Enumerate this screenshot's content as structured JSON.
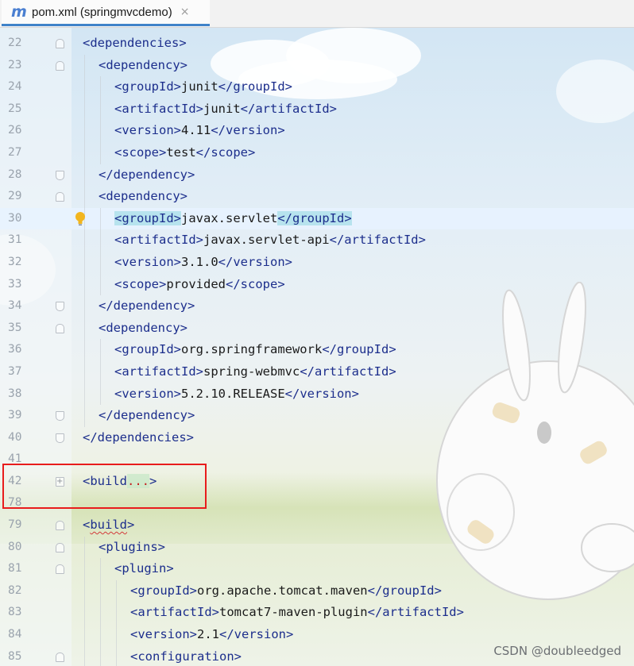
{
  "tab": {
    "icon": "m",
    "title": "pom.xml (springmvcdemo)",
    "close": "×"
  },
  "lines": [
    {
      "n": "22",
      "indent": 0,
      "fold": "start",
      "parts": [
        [
          "t",
          "<dependencies"
        ],
        [
          "t",
          ">"
        ]
      ]
    },
    {
      "n": "23",
      "indent": 1,
      "fold": "start",
      "parts": [
        [
          "t",
          "<dependency"
        ],
        [
          "t",
          ">"
        ]
      ]
    },
    {
      "n": "24",
      "indent": 2,
      "fold": "",
      "parts": [
        [
          "t",
          "<groupId"
        ],
        [
          "t",
          ">"
        ],
        [
          "v",
          "junit"
        ],
        [
          "t",
          "</groupId"
        ],
        [
          "t",
          ">"
        ]
      ]
    },
    {
      "n": "25",
      "indent": 2,
      "fold": "",
      "parts": [
        [
          "t",
          "<artifactId"
        ],
        [
          "t",
          ">"
        ],
        [
          "v",
          "junit"
        ],
        [
          "t",
          "</artifactId"
        ],
        [
          "t",
          ">"
        ]
      ]
    },
    {
      "n": "26",
      "indent": 2,
      "fold": "",
      "parts": [
        [
          "t",
          "<version"
        ],
        [
          "t",
          ">"
        ],
        [
          "v",
          "4.11"
        ],
        [
          "t",
          "</version"
        ],
        [
          "t",
          ">"
        ]
      ]
    },
    {
      "n": "27",
      "indent": 2,
      "fold": "",
      "parts": [
        [
          "t",
          "<scope"
        ],
        [
          "t",
          ">"
        ],
        [
          "v",
          "test"
        ],
        [
          "t",
          "</scope"
        ],
        [
          "t",
          ">"
        ]
      ]
    },
    {
      "n": "28",
      "indent": 1,
      "fold": "end",
      "parts": [
        [
          "t",
          "</dependency"
        ],
        [
          "t",
          ">"
        ]
      ]
    },
    {
      "n": "29",
      "indent": 1,
      "fold": "start",
      "parts": [
        [
          "t",
          "<dependency"
        ],
        [
          "t",
          ">"
        ]
      ]
    },
    {
      "n": "30",
      "indent": 2,
      "fold": "",
      "highlight": true,
      "bulb": true,
      "parts": [
        [
          "h",
          "<groupId>"
        ],
        [
          "v",
          "javax.servlet"
        ],
        [
          "h",
          "</groupId>"
        ]
      ]
    },
    {
      "n": "31",
      "indent": 2,
      "fold": "",
      "parts": [
        [
          "t",
          "<artifactId"
        ],
        [
          "t",
          ">"
        ],
        [
          "v",
          "javax.servlet-api"
        ],
        [
          "t",
          "</artifactId"
        ],
        [
          "t",
          ">"
        ]
      ]
    },
    {
      "n": "32",
      "indent": 2,
      "fold": "",
      "parts": [
        [
          "t",
          "<version"
        ],
        [
          "t",
          ">"
        ],
        [
          "v",
          "3.1.0"
        ],
        [
          "t",
          "</version"
        ],
        [
          "t",
          ">"
        ]
      ]
    },
    {
      "n": "33",
      "indent": 2,
      "fold": "",
      "parts": [
        [
          "t",
          "<scope"
        ],
        [
          "t",
          ">"
        ],
        [
          "v",
          "provided"
        ],
        [
          "t",
          "</scope"
        ],
        [
          "t",
          ">"
        ]
      ]
    },
    {
      "n": "34",
      "indent": 1,
      "fold": "end",
      "parts": [
        [
          "t",
          "</dependency"
        ],
        [
          "t",
          ">"
        ]
      ]
    },
    {
      "n": "35",
      "indent": 1,
      "fold": "start",
      "parts": [
        [
          "t",
          "<dependency"
        ],
        [
          "t",
          ">"
        ]
      ]
    },
    {
      "n": "36",
      "indent": 2,
      "fold": "",
      "parts": [
        [
          "t",
          "<groupId"
        ],
        [
          "t",
          ">"
        ],
        [
          "v",
          "org.springframework"
        ],
        [
          "t",
          "</groupId"
        ],
        [
          "t",
          ">"
        ]
      ]
    },
    {
      "n": "37",
      "indent": 2,
      "fold": "",
      "parts": [
        [
          "t",
          "<artifactId"
        ],
        [
          "t",
          ">"
        ],
        [
          "v",
          "spring-webmvc"
        ],
        [
          "t",
          "</artifactId"
        ],
        [
          "t",
          ">"
        ]
      ]
    },
    {
      "n": "38",
      "indent": 2,
      "fold": "",
      "parts": [
        [
          "t",
          "<version"
        ],
        [
          "t",
          ">"
        ],
        [
          "v",
          "5.2.10.RELEASE"
        ],
        [
          "t",
          "</version"
        ],
        [
          "t",
          ">"
        ]
      ]
    },
    {
      "n": "39",
      "indent": 1,
      "fold": "end",
      "parts": [
        [
          "t",
          "</dependency"
        ],
        [
          "t",
          ">"
        ]
      ]
    },
    {
      "n": "40",
      "indent": 0,
      "fold": "end",
      "parts": [
        [
          "t",
          "</dependencies"
        ],
        [
          "t",
          ">"
        ]
      ]
    },
    {
      "n": "41",
      "indent": 0,
      "fold": "",
      "parts": []
    },
    {
      "n": "42",
      "indent": 0,
      "fold": "plus",
      "parts": [
        [
          "t",
          "<build"
        ],
        [
          "d",
          "..."
        ],
        [
          "t",
          ">"
        ]
      ]
    },
    {
      "n": "78",
      "indent": 0,
      "fold": "",
      "parts": []
    },
    {
      "n": "79",
      "indent": 0,
      "fold": "start",
      "parts": [
        [
          "t",
          "<"
        ],
        [
          "s",
          "build"
        ],
        [
          "t",
          ">"
        ]
      ]
    },
    {
      "n": "80",
      "indent": 1,
      "fold": "start",
      "parts": [
        [
          "t",
          "<plugins"
        ],
        [
          "t",
          ">"
        ]
      ]
    },
    {
      "n": "81",
      "indent": 2,
      "fold": "start",
      "parts": [
        [
          "t",
          "<plugin"
        ],
        [
          "t",
          ">"
        ]
      ]
    },
    {
      "n": "82",
      "indent": 3,
      "fold": "",
      "parts": [
        [
          "t",
          "<groupId"
        ],
        [
          "t",
          ">"
        ],
        [
          "v",
          "org.apache.tomcat.maven"
        ],
        [
          "t",
          "</groupId"
        ],
        [
          "t",
          ">"
        ]
      ]
    },
    {
      "n": "83",
      "indent": 3,
      "fold": "",
      "parts": [
        [
          "t",
          "<artifactId"
        ],
        [
          "t",
          ">"
        ],
        [
          "v",
          "tomcat7-maven-plugin"
        ],
        [
          "t",
          "</artifactId"
        ],
        [
          "t",
          ">"
        ]
      ]
    },
    {
      "n": "84",
      "indent": 3,
      "fold": "",
      "parts": [
        [
          "t",
          "<version"
        ],
        [
          "t",
          ">"
        ],
        [
          "v",
          "2.1"
        ],
        [
          "t",
          "</version"
        ],
        [
          "t",
          ">"
        ]
      ]
    },
    {
      "n": "85",
      "indent": 3,
      "fold": "start",
      "parts": [
        [
          "t",
          "<configuration"
        ],
        [
          "t",
          ">"
        ]
      ]
    }
  ],
  "watermark": "CSDN @doubleedged",
  "colors": {
    "tag": "#1c2e8c",
    "text": "#1a1a1a",
    "line_number": "#9aa3ad",
    "annotation_box": "#e81c1c",
    "fold_dots": "#c51f1f",
    "tab_underline": "#4083c9"
  }
}
